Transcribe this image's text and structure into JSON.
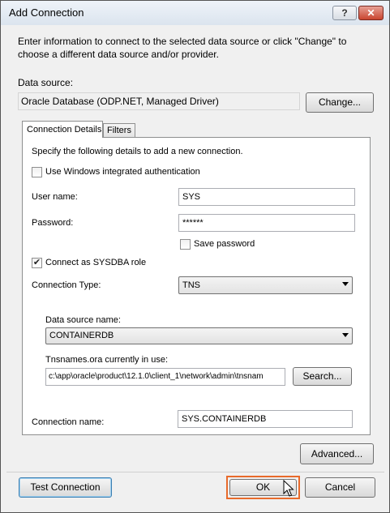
{
  "window": {
    "title": "Add Connection",
    "help_glyph": "?",
    "close_glyph": "✕"
  },
  "intro": {
    "line1": "Enter information to connect to the selected data source or click \"Change\" to",
    "line2": "choose a different data source and/or provider."
  },
  "data_source": {
    "label": "Data source:",
    "value": "Oracle Database (ODP.NET, Managed Driver)",
    "change_label": "Change..."
  },
  "tabs": [
    {
      "label": "Connection Details"
    },
    {
      "label": "Filters"
    }
  ],
  "details": {
    "instruction": "Specify the following details to add a new connection.",
    "windows_auth": {
      "label": "Use Windows integrated authentication",
      "checked": false
    },
    "user_name": {
      "label": "User name:",
      "value": "SYS"
    },
    "password": {
      "label": "Password:",
      "value": "******"
    },
    "save_password": {
      "label": "Save password",
      "checked": false
    },
    "sysdba": {
      "label": "Connect as SYSDBA role",
      "checked": true,
      "glyph": "✔"
    },
    "connection_type": {
      "label": "Connection Type:",
      "value": "TNS"
    },
    "data_source_name": {
      "label": "Data source name:",
      "value": "CONTAINERDB"
    },
    "tnsnames": {
      "label": "Tnsnames.ora currently in use:",
      "value": "c:\\app\\oracle\\product\\12.1.0\\client_1\\network\\admin\\tnsnam",
      "search_label": "Search..."
    },
    "connection_name": {
      "label": "Connection name:",
      "value": "SYS.CONTAINERDB"
    }
  },
  "buttons": {
    "advanced": "Advanced...",
    "test": "Test Connection",
    "ok": "OK",
    "cancel": "Cancel"
  },
  "colors": {
    "ok_highlight": "#e86a2b",
    "focus_blue": "#3c7fb1"
  },
  "icons": {
    "cursor": "mouse-cursor-icon"
  }
}
